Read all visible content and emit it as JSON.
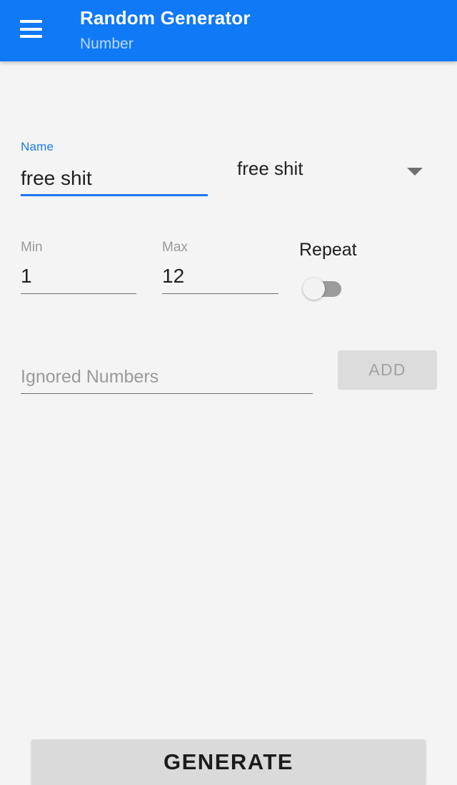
{
  "appbar": {
    "menu_icon": "hamburger-menu-icon",
    "title": "Random Generator",
    "subtitle": "Number",
    "background_color": "#1079f5",
    "title_color": "#ffffff",
    "subtitle_color": "#bcd9fc"
  },
  "form": {
    "name": {
      "label": "Name",
      "value": "free shit",
      "label_color": "#1a78ee",
      "underline_color": "#1a78ee"
    },
    "preset_spinner": {
      "selected": "free shit",
      "arrow_icon": "chevron-down-icon"
    },
    "min": {
      "label": "Min",
      "value": "1"
    },
    "max": {
      "label": "Max",
      "value": "12"
    },
    "repeat": {
      "label": "Repeat",
      "state": "off",
      "track_color": "#9b9b9b",
      "thumb_color": "#f2f2f2"
    },
    "ignored_numbers": {
      "placeholder": "Ignored Numbers",
      "value": ""
    },
    "add_button": {
      "label": "ADD",
      "enabled": false,
      "background_color": "#dcdcdc",
      "text_color": "#a2a2a2"
    }
  },
  "generate_button": {
    "label": "GENERATE",
    "background_color": "#dadada",
    "text_color": "#1c1c1c"
  },
  "page": {
    "background_color": "#f4f4f4"
  }
}
